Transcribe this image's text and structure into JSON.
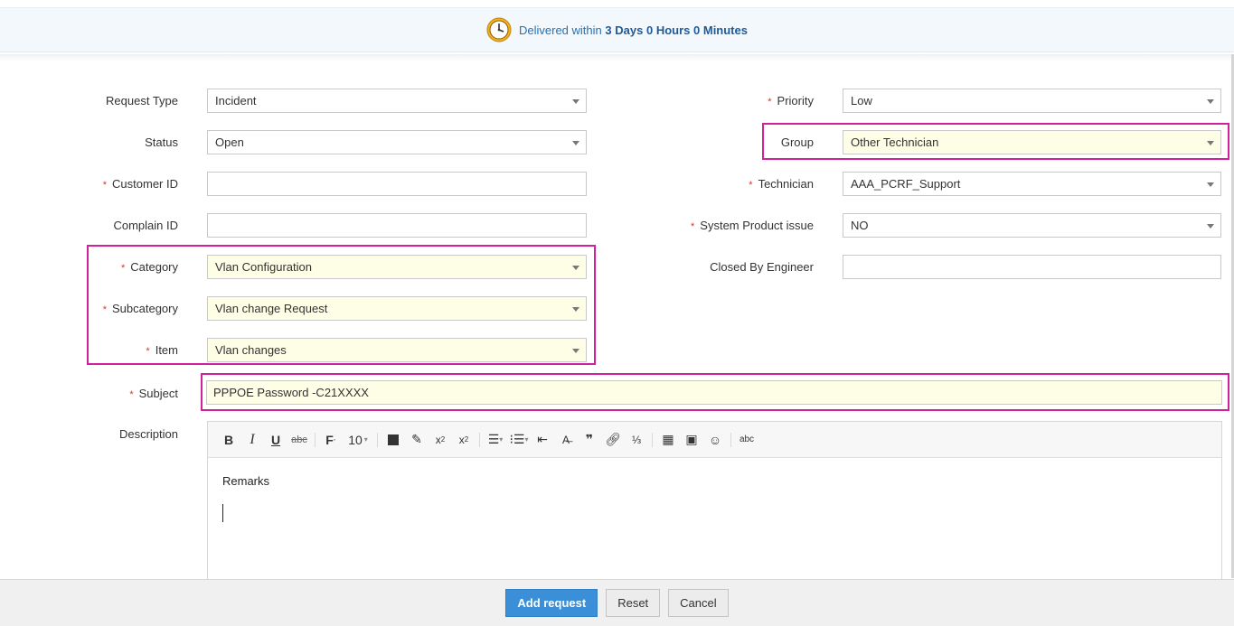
{
  "sla": {
    "prefix": "Delivered within",
    "days_num": "3",
    "days_unit": "Days",
    "hours_num": "0",
    "hours_unit": "Hours",
    "minutes_num": "0",
    "minutes_unit": "Minutes",
    "icon": "clock-icon"
  },
  "left_fields": {
    "request_type": {
      "label": "Request Type",
      "value": "Incident"
    },
    "status": {
      "label": "Status",
      "value": "Open"
    },
    "customer_id": {
      "label": "Customer ID",
      "value": ""
    },
    "complain_id": {
      "label": "Complain ID",
      "value": ""
    },
    "category": {
      "label": "Category",
      "value": "Vlan Configuration"
    },
    "subcategory": {
      "label": "Subcategory",
      "value": "Vlan change Request"
    },
    "item": {
      "label": "Item",
      "value": "Vlan changes"
    }
  },
  "right_fields": {
    "priority": {
      "label": "Priority",
      "value": "Low"
    },
    "group": {
      "label": "Group",
      "value": "Other Technician"
    },
    "technician": {
      "label": "Technician",
      "value": "AAA_PCRF_Support"
    },
    "system_product_issue": {
      "label": "System Product issue",
      "value": "NO"
    },
    "closed_by_engineer": {
      "label": "Closed By Engineer",
      "value": ""
    }
  },
  "subject": {
    "label": "Subject",
    "value": "PPPOE Password -C21XXXX"
  },
  "description": {
    "label": "Description",
    "font_size": "10",
    "body_text": "Remarks",
    "toolbar": [
      "bold-icon",
      "italic-icon",
      "underline-icon",
      "strikethrough-icon",
      "font-family-icon",
      "font-size-select",
      "text-color-icon",
      "highlight-icon",
      "subscript-icon",
      "superscript-icon",
      "align-icon",
      "list-icon",
      "indent-icon",
      "clear-format-icon",
      "blockquote-icon",
      "link-icon",
      "numbered-list-icon",
      "table-icon",
      "image-icon",
      "emoji-icon",
      "spellcheck-icon"
    ]
  },
  "required_marker": "*",
  "buttons": {
    "add": "Add request",
    "reset": "Reset",
    "cancel": "Cancel"
  },
  "colors": {
    "accent": "#3b8fd8",
    "highlight_frame": "#d1219a",
    "required": "#d9342b",
    "highlight_fill": "#fefee6"
  }
}
